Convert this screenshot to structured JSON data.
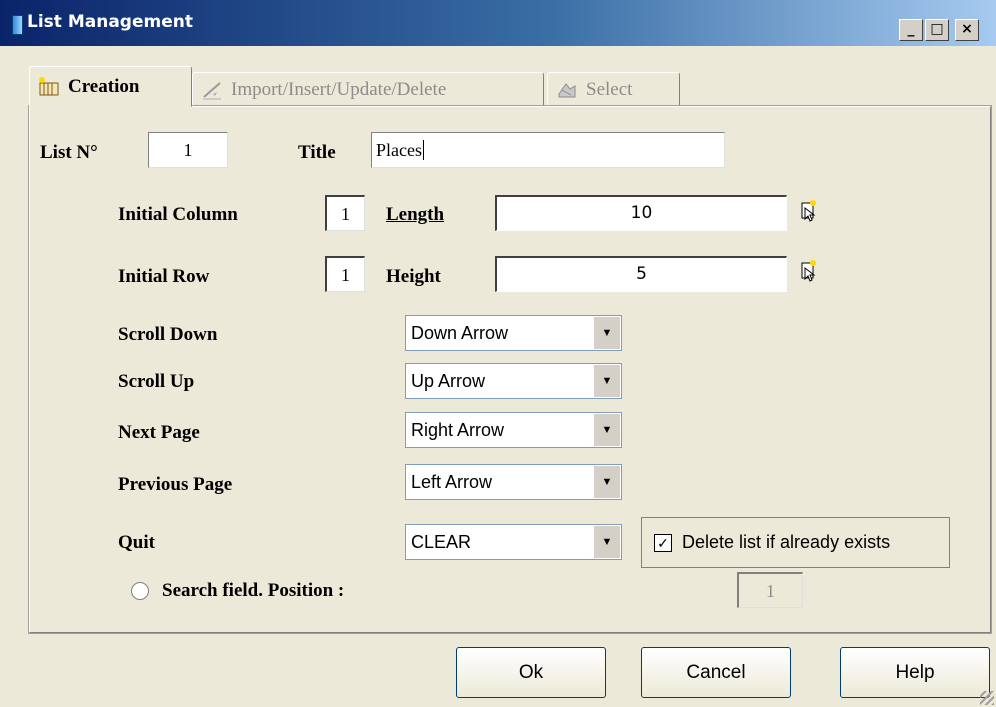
{
  "window": {
    "title": "List Management",
    "minimize_glyph": "_",
    "maximize_glyph": "□",
    "close_glyph": "×"
  },
  "tabs": [
    {
      "label": "Creation",
      "icon": "creation-icon",
      "active": true
    },
    {
      "label": "Import/Insert/Update/Delete",
      "icon": "edit-pencil-icon",
      "active": false
    },
    {
      "label": "Select",
      "icon": "select-icon",
      "active": false
    }
  ],
  "form": {
    "list_no_label": "List N°",
    "list_no_value": "1",
    "title_label": "Title",
    "title_value": "Places",
    "initial_column_label": "Initial Column",
    "initial_column_value": "1",
    "length_label": "Length",
    "length_value": "10",
    "initial_row_label": "Initial Row",
    "initial_row_value": "1",
    "height_label": "Height",
    "height_value": "5",
    "scroll_down_label": "Scroll Down",
    "scroll_down_value": "Down Arrow",
    "scroll_up_label": "Scroll Up",
    "scroll_up_value": "Up Arrow",
    "next_page_label": "Next Page",
    "next_page_value": "Right Arrow",
    "previous_page_label": "Previous Page",
    "previous_page_value": "Left Arrow",
    "quit_label": "Quit",
    "quit_value": "CLEAR",
    "delete_checkbox_label": "Delete list if already exists",
    "delete_checkbox_checked": true,
    "search_field_label": "Search field. Position :",
    "search_position_value": "1"
  },
  "buttons": {
    "ok": "Ok",
    "cancel": "Cancel",
    "help": "Help"
  },
  "colors": {
    "titlebar_start": "#0a246a",
    "titlebar_end": "#a6caf0",
    "dialog_bg": "#ece9d8"
  }
}
